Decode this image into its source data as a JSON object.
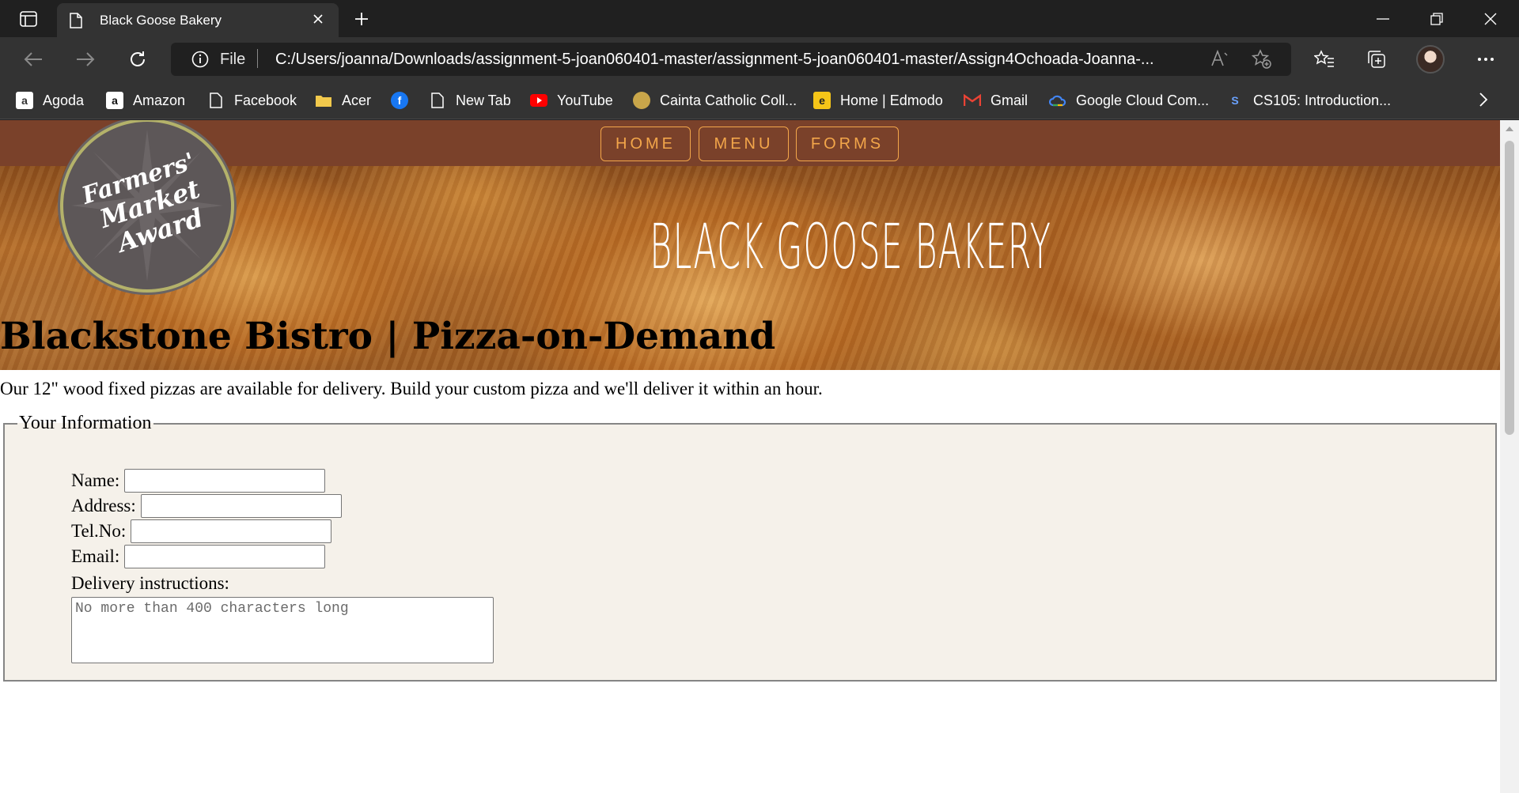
{
  "browser": {
    "tab_title": "Black Goose Bakery",
    "address_scheme_label": "File",
    "url": "C:/Users/joanna/Downloads/assignment-5-joan060401-master/assignment-5-joan060401-master/Assign4Ochoada-Joanna-...",
    "read_aloud_label": "Aⁱ",
    "bookmarks": [
      {
        "label": "Agoda",
        "icon": "agoda-icon"
      },
      {
        "label": "Amazon",
        "icon": "amazon-icon"
      },
      {
        "label": "Facebook",
        "icon": "page-icon"
      },
      {
        "label": "Acer",
        "icon": "folder-icon"
      },
      {
        "label": "",
        "icon": "facebook-icon"
      },
      {
        "label": "New Tab",
        "icon": "page-icon"
      },
      {
        "label": "YouTube",
        "icon": "youtube-icon"
      },
      {
        "label": "Cainta Catholic Coll...",
        "icon": "school-icon"
      },
      {
        "label": "Home | Edmodo",
        "icon": "edmodo-icon"
      },
      {
        "label": "Gmail",
        "icon": "gmail-icon"
      },
      {
        "label": "Google Cloud Com...",
        "icon": "google-cloud-icon"
      },
      {
        "label": "CS105: Introduction...",
        "icon": "course-icon"
      }
    ]
  },
  "site": {
    "nav": [
      "HOME",
      "MENU",
      "FORMS"
    ],
    "hero_title": "BLACK GOOSE BAKERY",
    "badge_text": [
      "Farmers'",
      "Market",
      "Award"
    ],
    "page_title": "Blackstone Bistro | Pizza-on-Demand",
    "intro": "Our 12\" wood fixed pizzas are available for delivery. Build your custom pizza and we'll deliver it within an hour.",
    "form": {
      "legend": "Your Information",
      "fields": [
        {
          "label": "Name:",
          "value": ""
        },
        {
          "label": "Address:",
          "value": ""
        },
        {
          "label": "Tel.No:",
          "value": ""
        },
        {
          "label": "Email:",
          "value": ""
        }
      ],
      "delivery_label": "Delivery instructions:",
      "delivery_placeholder": "No more than 400 characters long"
    }
  },
  "colors": {
    "nav_bg": "#7a412a",
    "nav_accent": "#f3a64a",
    "fieldset_bg": "#f5f1ea"
  }
}
